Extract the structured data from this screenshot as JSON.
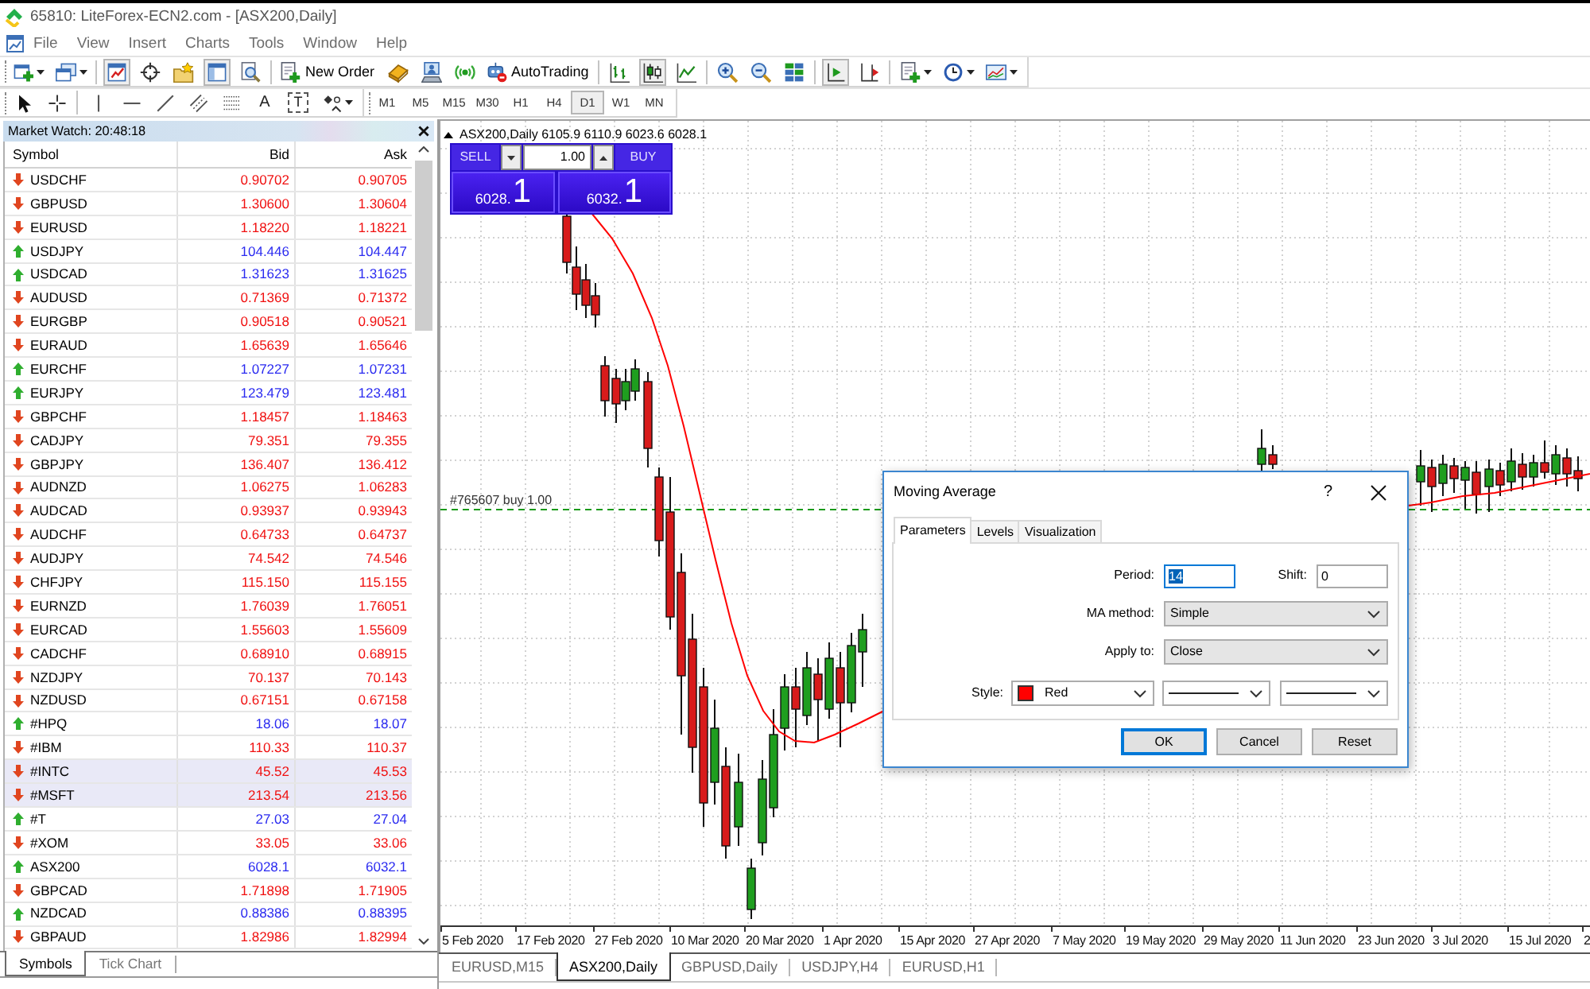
{
  "window": {
    "title": "65810: LiteForex-ECN2.com - [ASX200,Daily]"
  },
  "menu": [
    "File",
    "View",
    "Insert",
    "Charts",
    "Tools",
    "Window",
    "Help"
  ],
  "main_toolbar": [
    [
      {
        "pressed": false
      },
      {
        "pressed": false
      }
    ],
    [
      {
        "pressed": true
      },
      {
        "pressed": false
      },
      {
        "pressed": false
      },
      {
        "pressed": true
      },
      {
        "pressed": false
      }
    ],
    [
      {
        "label": "New Order",
        "pressed": false
      },
      {
        "pressed": false
      },
      {
        "pressed": false
      },
      {
        "pressed": false
      },
      {
        "label": "AutoTrading",
        "pressed": false
      }
    ],
    [
      {
        "pressed": false
      },
      {
        "pressed": true
      },
      {
        "pressed": false
      }
    ],
    [
      {
        "pressed": false
      },
      {
        "pressed": false
      },
      {
        "pressed": false
      }
    ],
    [
      {
        "pressed": true
      },
      {
        "pressed": false
      }
    ],
    [
      {
        "pressed": false
      },
      {
        "pressed": false
      },
      {
        "pressed": false
      }
    ]
  ],
  "drawing_toolbar": [
    [
      {
        "kind": "icon",
        "pressed": false
      },
      {
        "kind": "icon",
        "pressed": false
      }
    ],
    [
      {
        "kind": "icon",
        "pressed": false
      },
      {
        "kind": "icon",
        "pressed": false
      },
      {
        "kind": "icon",
        "pressed": false
      },
      {
        "kind": "icon",
        "pressed": false
      },
      {
        "kind": "icon",
        "pressed": false
      },
      {
        "kind": "glyph",
        "glyph": "A",
        "framed": false,
        "pressed": false
      },
      {
        "kind": "glyph",
        "glyph": "T",
        "framed": true,
        "pressed": false
      },
      {
        "kind": "icon",
        "pressed": false
      }
    ]
  ],
  "timeframes": [
    {
      "label": "M1",
      "selected": false
    },
    {
      "label": "M5",
      "selected": false
    },
    {
      "label": "M15",
      "selected": false
    },
    {
      "label": "M30",
      "selected": false
    },
    {
      "label": "H1",
      "selected": false
    },
    {
      "label": "H4",
      "selected": false
    },
    {
      "label": "D1",
      "selected": true
    },
    {
      "label": "W1",
      "selected": false
    },
    {
      "label": "MN",
      "selected": false
    }
  ],
  "market_watch": {
    "title": "Market Watch: 20:48:18",
    "columns": [
      "Symbol",
      "Bid",
      "Ask"
    ],
    "rows": [
      {
        "symbol": "USDCHF",
        "bid": "0.90702",
        "ask": "0.90705",
        "kind": "down",
        "selected": false
      },
      {
        "symbol": "GBPUSD",
        "bid": "1.30600",
        "ask": "1.30604",
        "kind": "down",
        "selected": false
      },
      {
        "symbol": "EURUSD",
        "bid": "1.18220",
        "ask": "1.18221",
        "kind": "down",
        "selected": false
      },
      {
        "symbol": "USDJPY",
        "bid": "104.446",
        "ask": "104.447",
        "kind": "up",
        "selected": false
      },
      {
        "symbol": "USDCAD",
        "bid": "1.31623",
        "ask": "1.31625",
        "kind": "up",
        "selected": false
      },
      {
        "symbol": "AUDUSD",
        "bid": "0.71369",
        "ask": "0.71372",
        "kind": "down",
        "selected": false
      },
      {
        "symbol": "EURGBP",
        "bid": "0.90518",
        "ask": "0.90521",
        "kind": "down",
        "selected": false
      },
      {
        "symbol": "EURAUD",
        "bid": "1.65639",
        "ask": "1.65646",
        "kind": "down",
        "selected": false
      },
      {
        "symbol": "EURCHF",
        "bid": "1.07227",
        "ask": "1.07231",
        "kind": "up",
        "selected": false
      },
      {
        "symbol": "EURJPY",
        "bid": "123.479",
        "ask": "123.481",
        "kind": "up",
        "selected": false
      },
      {
        "symbol": "GBPCHF",
        "bid": "1.18457",
        "ask": "1.18463",
        "kind": "down",
        "selected": false
      },
      {
        "symbol": "CADJPY",
        "bid": "79.351",
        "ask": "79.355",
        "kind": "down",
        "selected": false
      },
      {
        "symbol": "GBPJPY",
        "bid": "136.407",
        "ask": "136.412",
        "kind": "down",
        "selected": false
      },
      {
        "symbol": "AUDNZD",
        "bid": "1.06275",
        "ask": "1.06283",
        "kind": "down",
        "selected": false
      },
      {
        "symbol": "AUDCAD",
        "bid": "0.93937",
        "ask": "0.93943",
        "kind": "down",
        "selected": false
      },
      {
        "symbol": "AUDCHF",
        "bid": "0.64733",
        "ask": "0.64737",
        "kind": "down",
        "selected": false
      },
      {
        "symbol": "AUDJPY",
        "bid": "74.542",
        "ask": "74.546",
        "kind": "down",
        "selected": false
      },
      {
        "symbol": "CHFJPY",
        "bid": "115.150",
        "ask": "115.155",
        "kind": "down",
        "selected": false
      },
      {
        "symbol": "EURNZD",
        "bid": "1.76039",
        "ask": "1.76051",
        "kind": "down",
        "selected": false
      },
      {
        "symbol": "EURCAD",
        "bid": "1.55603",
        "ask": "1.55609",
        "kind": "down",
        "selected": false
      },
      {
        "symbol": "CADCHF",
        "bid": "0.68910",
        "ask": "0.68915",
        "kind": "down",
        "selected": false
      },
      {
        "symbol": "NZDJPY",
        "bid": "70.137",
        "ask": "70.143",
        "kind": "down",
        "selected": false
      },
      {
        "symbol": "NZDUSD",
        "bid": "0.67151",
        "ask": "0.67158",
        "kind": "down",
        "selected": false
      },
      {
        "symbol": "#HPQ",
        "bid": "18.06",
        "ask": "18.07",
        "kind": "up",
        "selected": false
      },
      {
        "symbol": "#IBM",
        "bid": "110.33",
        "ask": "110.37",
        "kind": "down",
        "selected": false
      },
      {
        "symbol": "#INTC",
        "bid": "45.52",
        "ask": "45.53",
        "kind": "down",
        "selected": true
      },
      {
        "symbol": "#MSFT",
        "bid": "213.54",
        "ask": "213.56",
        "kind": "down",
        "selected": true
      },
      {
        "symbol": "#T",
        "bid": "27.03",
        "ask": "27.04",
        "kind": "up",
        "selected": false
      },
      {
        "symbol": "#XOM",
        "bid": "33.05",
        "ask": "33.06",
        "kind": "down",
        "selected": false
      },
      {
        "symbol": "ASX200",
        "bid": "6028.1",
        "ask": "6032.1",
        "kind": "up",
        "selected": false
      },
      {
        "symbol": "GBPCAD",
        "bid": "1.71898",
        "ask": "1.71905",
        "kind": "down",
        "selected": false
      },
      {
        "symbol": "NZDCAD",
        "bid": "0.88386",
        "ask": "0.88395",
        "kind": "up",
        "selected": false
      },
      {
        "symbol": "GBPAUD",
        "bid": "1.82986",
        "ask": "1.82994",
        "kind": "down",
        "selected": false
      }
    ],
    "tabs": [
      {
        "label": "Symbols",
        "selected": true
      },
      {
        "label": "Tick Chart",
        "selected": false
      }
    ]
  },
  "chart": {
    "symbol": "ASX200,Daily",
    "ohlc": [
      "6105.9",
      "6110.9",
      "6023.6",
      "6028.1"
    ],
    "one_click": {
      "sell": "SELL",
      "volume": "1.00",
      "buy": "BUY",
      "sell_price": {
        "prefix": "6028.",
        "large": "1"
      },
      "buy_price": {
        "prefix": "6032.",
        "large": "1"
      }
    },
    "order_line": {
      "label": "#765607 buy 1.00"
    },
    "x_axis_labels": [
      "5 Feb 2020",
      "17 Feb 2020",
      "27 Feb 2020",
      "10 Mar 2020",
      "20 Mar 2020",
      "1 Apr 2020",
      "15 Apr 2020",
      "27 Apr 2020",
      "7 May 2020",
      "19 May 2020",
      "29 May 2020",
      "11 Jun 2020",
      "23 Jun 2020",
      "3 Jul 2020",
      "15 Jul 2020",
      "2"
    ]
  },
  "chart_tabs": [
    {
      "label": "EURUSD,M15",
      "selected": false
    },
    {
      "label": "ASX200,Daily",
      "selected": true
    },
    {
      "label": "GBPUSD,Daily",
      "selected": false
    },
    {
      "label": "USDJPY,H4",
      "selected": false
    },
    {
      "label": "EURUSD,H1",
      "selected": false
    }
  ],
  "dialog": {
    "title": "Moving Average",
    "help": "?",
    "tabs": [
      {
        "label": "Parameters",
        "selected": true
      },
      {
        "label": "Levels",
        "selected": false
      },
      {
        "label": "Visualization",
        "selected": false
      }
    ],
    "period": {
      "label": "Period:",
      "value": "14",
      "value_selected": true,
      "focused": true
    },
    "shift": {
      "label": "Shift:",
      "value": "0",
      "focused": false
    },
    "ma_method": {
      "label": "MA method:",
      "value": "Simple"
    },
    "apply_to": {
      "label": "Apply to:",
      "value": "Close"
    },
    "style": {
      "label": "Style:",
      "color_name": "Red",
      "color": "#ff0000"
    },
    "buttons": [
      {
        "label": "OK",
        "default": true
      },
      {
        "label": "Cancel",
        "default": false
      },
      {
        "label": "Reset",
        "default": false
      }
    ]
  }
}
